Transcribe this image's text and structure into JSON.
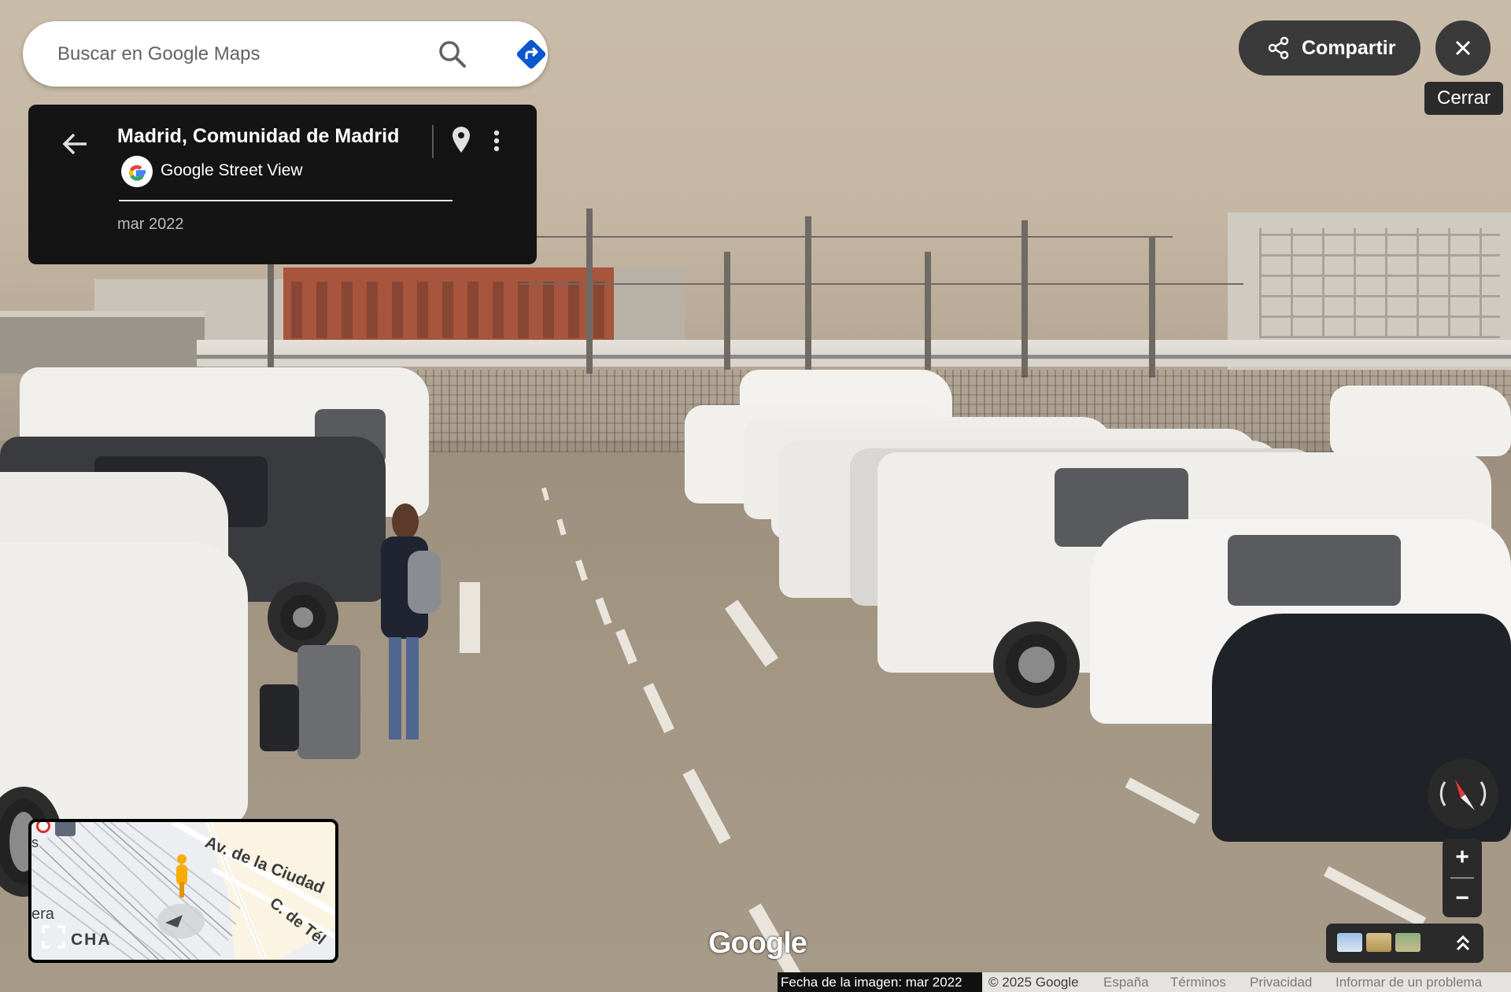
{
  "search": {
    "placeholder": "Buscar en Google Maps"
  },
  "place": {
    "title": "Madrid, Comunidad de Madrid",
    "provider": "Google Street View",
    "capture_date": "mar 2022"
  },
  "top_controls": {
    "share_label": "Compartir",
    "close_tooltip": "Cerrar"
  },
  "minimap": {
    "streets": [
      "Av. de la Ciudad",
      "C. de Tél",
      "era",
      "CHA",
      "s"
    ]
  },
  "zoom": {
    "in_label": "+",
    "out_label": "−"
  },
  "branding": {
    "wordmark": "Google"
  },
  "footer": {
    "image_date": "Fecha de la imagen: mar 2022",
    "copyright": "© 2025 Google",
    "region": "España",
    "terms": "Términos",
    "privacy": "Privacidad",
    "report": "Informar de un problema"
  },
  "colors": {
    "directions_blue": "#0b57d0",
    "panel_dark": "#141414",
    "button_dark": "#3a3a3a",
    "pegman_yellow": "#f9ab00"
  },
  "icons": [
    "search-icon",
    "directions-icon",
    "back-arrow-icon",
    "google-g-icon",
    "location-pin-icon",
    "more-vert-icon",
    "share-icon",
    "close-icon",
    "expand-icon",
    "pegman-icon",
    "compass-icon",
    "chevron-up-icon"
  ]
}
